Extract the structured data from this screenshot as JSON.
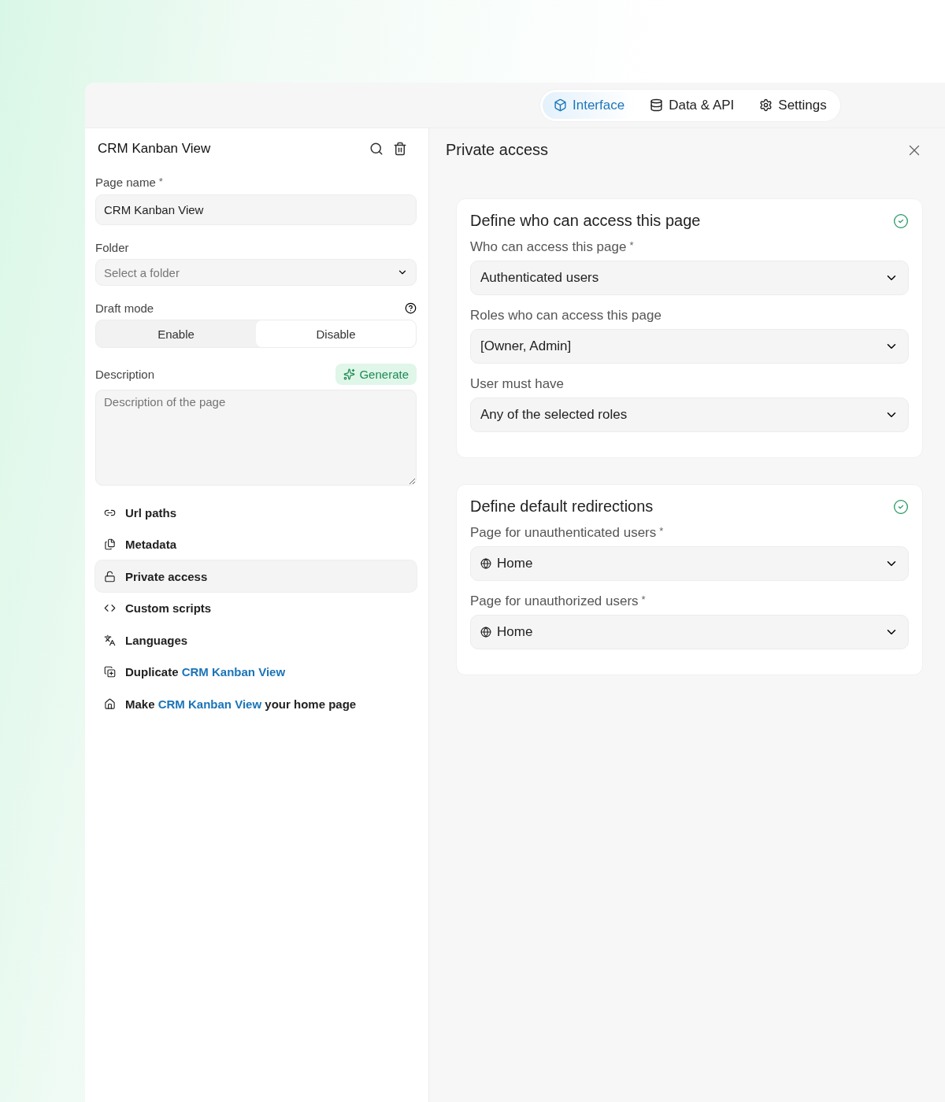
{
  "tabs": [
    {
      "label": "Interface",
      "selected": true
    },
    {
      "label": "Data & API",
      "selected": false
    },
    {
      "label": "Settings",
      "selected": false
    }
  ],
  "sidebar": {
    "title": "CRM Kanban View",
    "page_name": {
      "label": "Page name",
      "marker": "*",
      "value": "CRM Kanban View"
    },
    "folder": {
      "label": "Folder",
      "placeholder": "Select a folder"
    },
    "draft_mode": {
      "label": "Draft mode",
      "options": [
        {
          "label": "Enable",
          "selected": false
        },
        {
          "label": "Disable",
          "selected": true
        }
      ]
    },
    "description": {
      "label": "Description",
      "generate": "Generate",
      "placeholder": "Description of the page"
    },
    "items": [
      {
        "parts": [
          {
            "text": "Url paths",
            "highlight": false
          }
        ],
        "selected": false
      },
      {
        "parts": [
          {
            "text": "Metadata",
            "highlight": false
          }
        ],
        "selected": false
      },
      {
        "parts": [
          {
            "text": "Private access",
            "highlight": false
          }
        ],
        "selected": true
      },
      {
        "parts": [
          {
            "text": "Custom scripts",
            "highlight": false
          }
        ],
        "selected": false
      },
      {
        "parts": [
          {
            "text": "Languages",
            "highlight": false
          }
        ],
        "selected": false
      },
      {
        "parts": [
          {
            "text": "Duplicate ",
            "highlight": false
          },
          {
            "text": "CRM Kanban View",
            "highlight": true
          }
        ],
        "selected": false
      },
      {
        "parts": [
          {
            "text": "Make ",
            "highlight": false
          },
          {
            "text": "CRM Kanban View",
            "highlight": true
          },
          {
            "text": " your home page",
            "highlight": false
          }
        ],
        "selected": false
      }
    ]
  },
  "panel": {
    "title": "Private access",
    "sections": [
      {
        "title": "Define who can access this page",
        "complete": true,
        "fields": [
          {
            "label": "Who can access this page",
            "marker": "*",
            "kind": "text",
            "value": "Authenticated users"
          },
          {
            "label": "Roles who can access this page",
            "kind": "text",
            "value": "[Owner, Admin]"
          },
          {
            "label": "User must have",
            "kind": "text",
            "value": "Any of the selected roles"
          }
        ]
      },
      {
        "title": "Define default redirections",
        "complete": true,
        "fields": [
          {
            "label": "Page for unauthenticated users",
            "marker": "*",
            "kind": "page",
            "value": "Home"
          },
          {
            "label": "Page for unauthorized users",
            "marker": "*",
            "kind": "page",
            "value": "Home"
          }
        ]
      }
    ]
  }
}
